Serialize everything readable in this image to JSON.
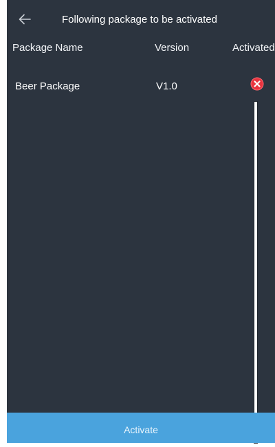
{
  "header": {
    "title": "Following package to be activated",
    "back_icon": "arrow-left-icon"
  },
  "table": {
    "columns": [
      "Package Name",
      "Version",
      "Activated"
    ],
    "rows": [
      {
        "name": "Beer Package",
        "version": "V1.0",
        "activated": false,
        "status_icon": "red-x-circle-icon"
      }
    ]
  },
  "footer": {
    "activate_label": "Activate"
  },
  "colors": {
    "background": "#2c343f",
    "button": "#4aa3dd",
    "status_inactive": "#e8343f"
  }
}
